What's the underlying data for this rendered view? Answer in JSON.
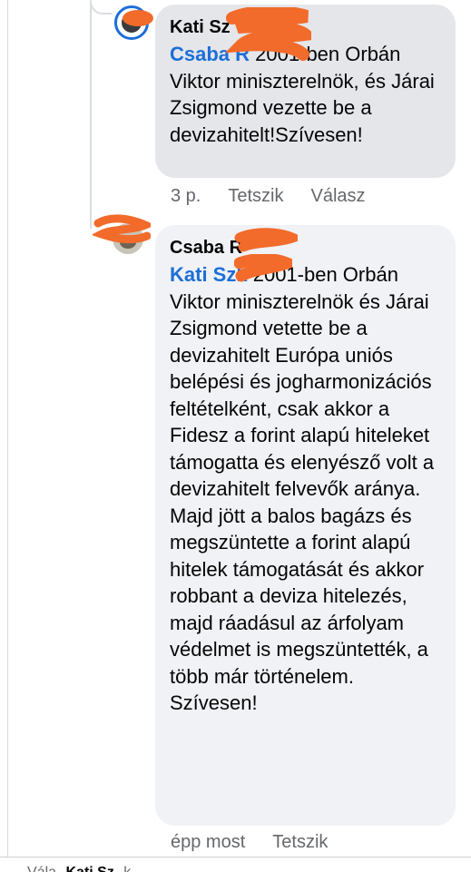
{
  "comments": [
    {
      "author": "Kati Sz",
      "mention": "Csaba R",
      "text": "2001-ben Orbán Viktor miniszterelnök, és Járai Zsigmond vezette be a devizahitelt!Szívesen!",
      "time": "3 p.",
      "like_label": "Tetszik",
      "reply_label": "Válasz"
    },
    {
      "author": "Csaba R",
      "mention": "Kati Sz",
      "mention_suffix": "k",
      "text": " 2001-ben Orbán Viktor miniszterelnök és Járai Zsigmond vetette be a devizahitelt Európa uniós belépési és jogharmonizációs feltételként, csak akkor a Fidesz a forint alapú hiteleket támogatta és elenyésző volt a devizahitelt felvevők aránya. Majd jött a balos bagázs és megszüntette a forint alapú hitelek támogatását és akkor robbant a deviza hitelezés, majd ráadásul az árfolyam védelmet is megszüntették, a több már történelem. Szívesen!",
      "time": "épp most",
      "like_label": "Tetszik"
    }
  ],
  "footer": {
    "reply_prefix": "Vála",
    "reply_name": "Kati Sz",
    "reply_suffix": "k ..."
  },
  "colors": {
    "scribble": "#f26b2a",
    "mention": "#1d6ed8",
    "bubble_gray": "#e4e6ea",
    "bubble_light": "#f0f2f5"
  }
}
